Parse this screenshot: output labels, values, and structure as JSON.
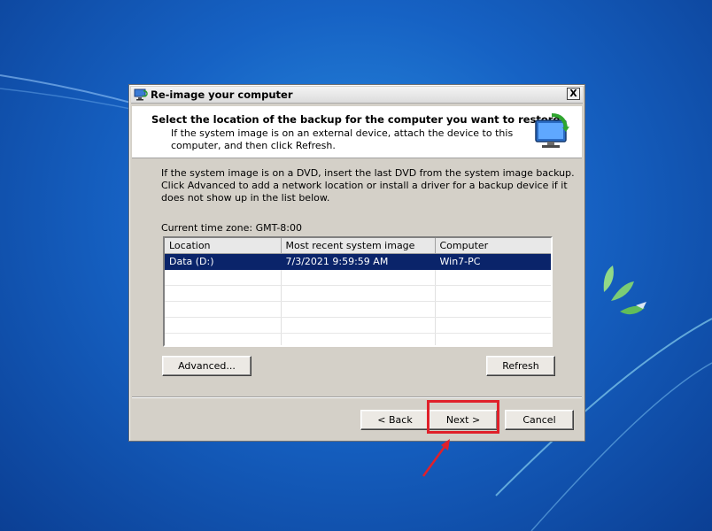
{
  "window": {
    "title": "Re-image your computer",
    "close_label": "X"
  },
  "header": {
    "title": "Select the location of the backup for the computer you want to restore",
    "subtitle": "If the system image is on an external device, attach the device to this computer, and then click Refresh."
  },
  "body": {
    "intro": "If the system image is on a DVD, insert the last DVD from the system image backup. Click Advanced to add a network location or install a driver for a backup device if it does not show up in the list below.",
    "timezone": "Current time zone: GMT-8:00"
  },
  "table": {
    "columns": [
      "Location",
      "Most recent system image",
      "Computer"
    ],
    "rows": [
      {
        "location": "Data (D:)",
        "image": "7/3/2021 9:59:59 AM",
        "computer": "Win7-PC",
        "selected": true
      },
      {
        "location": "",
        "image": "",
        "computer": "",
        "selected": false
      },
      {
        "location": "",
        "image": "",
        "computer": "",
        "selected": false
      },
      {
        "location": "",
        "image": "",
        "computer": "",
        "selected": false
      },
      {
        "location": "",
        "image": "",
        "computer": "",
        "selected": false
      },
      {
        "location": "",
        "image": "",
        "computer": "",
        "selected": false
      }
    ]
  },
  "buttons": {
    "advanced": "Advanced...",
    "refresh": "Refresh",
    "back": "< Back",
    "next": "Next >",
    "cancel": "Cancel"
  },
  "annotation": {
    "highlight_color": "#e0202a"
  },
  "icons": {
    "app": "computer-restore-icon",
    "header": "monitor-restore-icon"
  }
}
